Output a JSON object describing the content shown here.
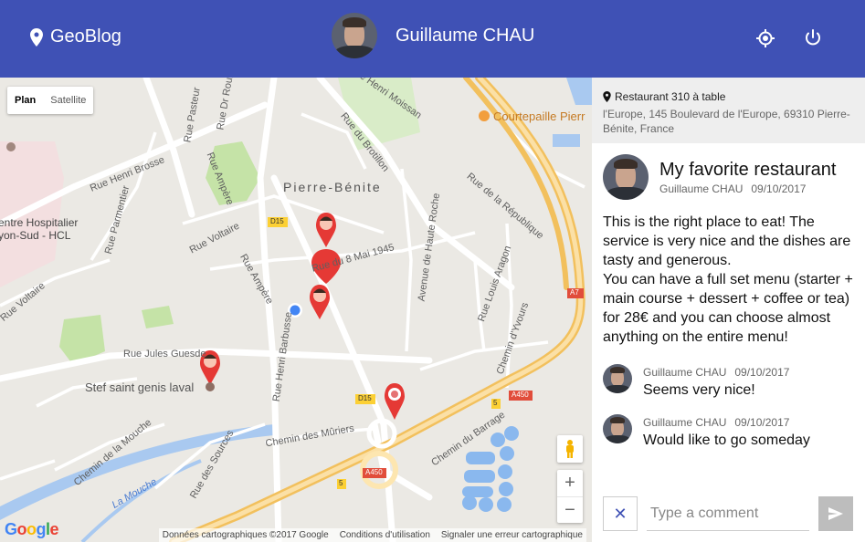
{
  "header": {
    "app_name": "GeoBlog",
    "user_name": "Guillaume CHAU",
    "locate_icon": "crosshair-icon",
    "logout_icon": "power-icon",
    "color": "#3f51b5"
  },
  "map": {
    "toggle": {
      "plan": "Plan",
      "satellite": "Satellite",
      "selected": "Plan"
    },
    "labels": {
      "town": "Pierre-Bénite",
      "hospital_1": "entre Hospitalier",
      "hospital_2": "yon-Sud - HCL",
      "rue_henri_brosse": "Rue Henri Brosse",
      "rue_ampere": "Rue Ampère",
      "rue_voltaire": "Rue Voltaire",
      "rue_voltaire_2": "Rue Voltaire",
      "rue_parmentier": "Rue Parmentier",
      "rue_pasteur": "Rue Pasteur",
      "rue_du_roux": "Rue Dr Roux",
      "rue_henri_moissan": "Rue Henri Moissan",
      "rue_du_brotillon": "Rue du Brotillon",
      "rue_de_la_republique": "Rue de la République",
      "rue_du_8_mai": "Rue du 8 Mai 1945",
      "avenue_haute_roche": "Avenue de Haute Roche",
      "rue_louis_aragon": "Rue Louis Aragon",
      "rue_ampere_2": "Rue Ampère",
      "rue_henri_barbusse": "Rue Henri Barbusse",
      "rue_jules_guesde": "Rue Jules Guesde",
      "chemin_yvours": "Chemin d'Yvours",
      "chemin_murier": "Chemin des Mûriers",
      "chemin_mouche": "Chemin de la Mouche",
      "la_mouche": "La Mouche",
      "rue_des_sources": "Rue des Sources",
      "chemin_barrage": "Chemin du Barrage",
      "courtepaille": "Courtepaille Pierr",
      "stef": "Stef saint genis laval",
      "d15_a": "D15",
      "d15_b": "D15",
      "a450_a": "A450",
      "a450_b": "A450",
      "a7": "A7",
      "r5_a": "5",
      "r5_b": "5"
    },
    "zoom_in": "+",
    "zoom_out": "−",
    "footer": {
      "data": "Données cartographiques ©2017 Google",
      "terms": "Conditions d'utilisation",
      "report": "Signaler une erreur cartographique"
    },
    "google": "Google"
  },
  "place": {
    "name": "Restaurant 310 à table",
    "address": "l'Europe, 145 Boulevard de l'Europe, 69310 Pierre-Bénite, France"
  },
  "post": {
    "title": "My favorite restaurant",
    "author": "Guillaume CHAU",
    "date": "09/10/2017",
    "body_1": "This is the right place to eat! The service is very nice and the dishes are tasty and generous.",
    "body_2": "You can have a full set menu (starter + main course + dessert + coffee or tea) for 28€ and you can choose almost anything on the entire menu!"
  },
  "comments": [
    {
      "author": "Guillaume CHAU",
      "date": "09/10/2017",
      "text": "Seems very nice!"
    },
    {
      "author": "Guillaume CHAU",
      "date": "09/10/2017",
      "text": "Would like to go someday"
    }
  ],
  "composer": {
    "placeholder": "Type a comment",
    "cancel_icon": "close-icon",
    "send_icon": "send-icon"
  }
}
